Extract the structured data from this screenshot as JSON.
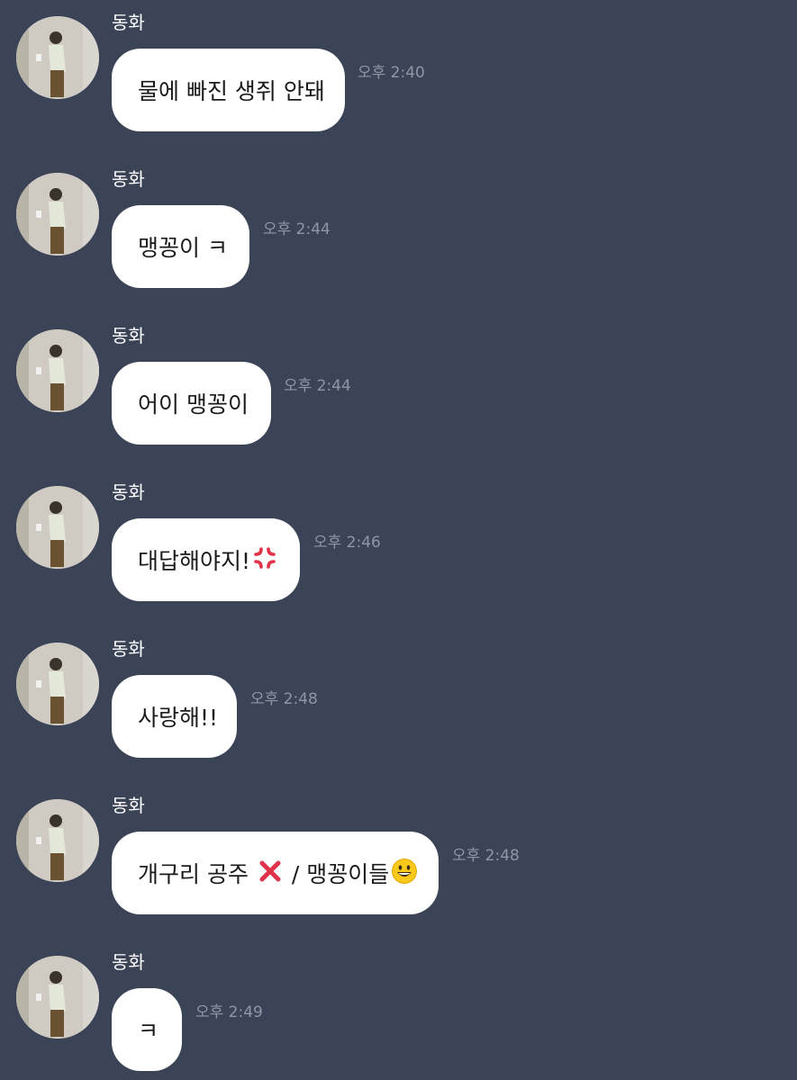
{
  "chat": {
    "background_color": "#3b4357",
    "messages": [
      {
        "sender": "동화",
        "text": "물에 빠진 생쥐 안돼",
        "time": "오후 2:40"
      },
      {
        "sender": "동화",
        "text": "맹꽁이 ㅋ",
        "time": "오후 2:44"
      },
      {
        "sender": "동화",
        "text": "어이 맹꽁이",
        "time": "오후 2:44"
      },
      {
        "sender": "동화",
        "text": "대답해야지!",
        "emoji": "anger-symbol-icon",
        "time": "오후 2:46"
      },
      {
        "sender": "동화",
        "text": "사랑해!!",
        "time": "오후 2:48"
      },
      {
        "sender": "동화",
        "text_before": "개구리 공주 ",
        "emoji_1": "cross-mark-icon",
        "text_after": " / 맹꽁이들",
        "emoji_2": "grinning-face-icon",
        "time": "오후 2:48"
      },
      {
        "sender": "동화",
        "text": "ㅋ",
        "time": "오후 2:49"
      }
    ]
  }
}
